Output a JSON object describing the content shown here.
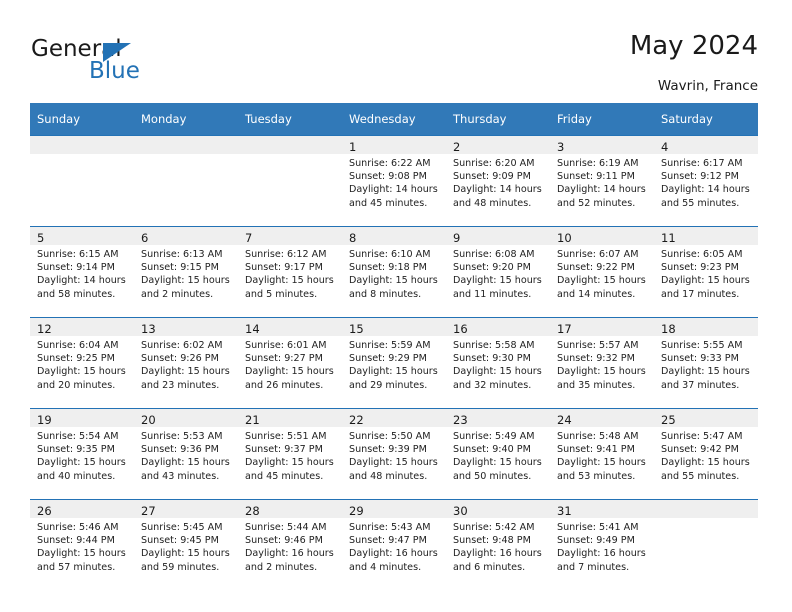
{
  "logo": {
    "word_top": "General",
    "word_bottom": "Blue",
    "triangle_icon": "blue-triangle-icon",
    "brand_color": "#2372b5"
  },
  "header": {
    "title": "May 2024",
    "subtitle": "Wavrin, France"
  },
  "theme": {
    "header_row_bg": "#3179b8",
    "header_row_text": "#ffffff",
    "row_rule": "#2372b5",
    "daynum_strip_bg": "#efefef",
    "page_bg": "#ffffff",
    "body_text": "#222222"
  },
  "calendar": {
    "weekday_headers": [
      "Sunday",
      "Monday",
      "Tuesday",
      "Wednesday",
      "Thursday",
      "Friday",
      "Saturday"
    ],
    "labels": {
      "sunrise": "Sunrise:",
      "sunset": "Sunset:",
      "daylight": "Daylight:"
    },
    "weeks": [
      [
        {
          "day": "",
          "lines": []
        },
        {
          "day": "",
          "lines": []
        },
        {
          "day": "",
          "lines": []
        },
        {
          "day": "1",
          "lines": [
            "Sunrise: 6:22 AM",
            "Sunset: 9:08 PM",
            "Daylight: 14 hours",
            "and 45 minutes."
          ]
        },
        {
          "day": "2",
          "lines": [
            "Sunrise: 6:20 AM",
            "Sunset: 9:09 PM",
            "Daylight: 14 hours",
            "and 48 minutes."
          ]
        },
        {
          "day": "3",
          "lines": [
            "Sunrise: 6:19 AM",
            "Sunset: 9:11 PM",
            "Daylight: 14 hours",
            "and 52 minutes."
          ]
        },
        {
          "day": "4",
          "lines": [
            "Sunrise: 6:17 AM",
            "Sunset: 9:12 PM",
            "Daylight: 14 hours",
            "and 55 minutes."
          ]
        }
      ],
      [
        {
          "day": "5",
          "lines": [
            "Sunrise: 6:15 AM",
            "Sunset: 9:14 PM",
            "Daylight: 14 hours",
            "and 58 minutes."
          ]
        },
        {
          "day": "6",
          "lines": [
            "Sunrise: 6:13 AM",
            "Sunset: 9:15 PM",
            "Daylight: 15 hours",
            "and 2 minutes."
          ]
        },
        {
          "day": "7",
          "lines": [
            "Sunrise: 6:12 AM",
            "Sunset: 9:17 PM",
            "Daylight: 15 hours",
            "and 5 minutes."
          ]
        },
        {
          "day": "8",
          "lines": [
            "Sunrise: 6:10 AM",
            "Sunset: 9:18 PM",
            "Daylight: 15 hours",
            "and 8 minutes."
          ]
        },
        {
          "day": "9",
          "lines": [
            "Sunrise: 6:08 AM",
            "Sunset: 9:20 PM",
            "Daylight: 15 hours",
            "and 11 minutes."
          ]
        },
        {
          "day": "10",
          "lines": [
            "Sunrise: 6:07 AM",
            "Sunset: 9:22 PM",
            "Daylight: 15 hours",
            "and 14 minutes."
          ]
        },
        {
          "day": "11",
          "lines": [
            "Sunrise: 6:05 AM",
            "Sunset: 9:23 PM",
            "Daylight: 15 hours",
            "and 17 minutes."
          ]
        }
      ],
      [
        {
          "day": "12",
          "lines": [
            "Sunrise: 6:04 AM",
            "Sunset: 9:25 PM",
            "Daylight: 15 hours",
            "and 20 minutes."
          ]
        },
        {
          "day": "13",
          "lines": [
            "Sunrise: 6:02 AM",
            "Sunset: 9:26 PM",
            "Daylight: 15 hours",
            "and 23 minutes."
          ]
        },
        {
          "day": "14",
          "lines": [
            "Sunrise: 6:01 AM",
            "Sunset: 9:27 PM",
            "Daylight: 15 hours",
            "and 26 minutes."
          ]
        },
        {
          "day": "15",
          "lines": [
            "Sunrise: 5:59 AM",
            "Sunset: 9:29 PM",
            "Daylight: 15 hours",
            "and 29 minutes."
          ]
        },
        {
          "day": "16",
          "lines": [
            "Sunrise: 5:58 AM",
            "Sunset: 9:30 PM",
            "Daylight: 15 hours",
            "and 32 minutes."
          ]
        },
        {
          "day": "17",
          "lines": [
            "Sunrise: 5:57 AM",
            "Sunset: 9:32 PM",
            "Daylight: 15 hours",
            "and 35 minutes."
          ]
        },
        {
          "day": "18",
          "lines": [
            "Sunrise: 5:55 AM",
            "Sunset: 9:33 PM",
            "Daylight: 15 hours",
            "and 37 minutes."
          ]
        }
      ],
      [
        {
          "day": "19",
          "lines": [
            "Sunrise: 5:54 AM",
            "Sunset: 9:35 PM",
            "Daylight: 15 hours",
            "and 40 minutes."
          ]
        },
        {
          "day": "20",
          "lines": [
            "Sunrise: 5:53 AM",
            "Sunset: 9:36 PM",
            "Daylight: 15 hours",
            "and 43 minutes."
          ]
        },
        {
          "day": "21",
          "lines": [
            "Sunrise: 5:51 AM",
            "Sunset: 9:37 PM",
            "Daylight: 15 hours",
            "and 45 minutes."
          ]
        },
        {
          "day": "22",
          "lines": [
            "Sunrise: 5:50 AM",
            "Sunset: 9:39 PM",
            "Daylight: 15 hours",
            "and 48 minutes."
          ]
        },
        {
          "day": "23",
          "lines": [
            "Sunrise: 5:49 AM",
            "Sunset: 9:40 PM",
            "Daylight: 15 hours",
            "and 50 minutes."
          ]
        },
        {
          "day": "24",
          "lines": [
            "Sunrise: 5:48 AM",
            "Sunset: 9:41 PM",
            "Daylight: 15 hours",
            "and 53 minutes."
          ]
        },
        {
          "day": "25",
          "lines": [
            "Sunrise: 5:47 AM",
            "Sunset: 9:42 PM",
            "Daylight: 15 hours",
            "and 55 minutes."
          ]
        }
      ],
      [
        {
          "day": "26",
          "lines": [
            "Sunrise: 5:46 AM",
            "Sunset: 9:44 PM",
            "Daylight: 15 hours",
            "and 57 minutes."
          ]
        },
        {
          "day": "27",
          "lines": [
            "Sunrise: 5:45 AM",
            "Sunset: 9:45 PM",
            "Daylight: 15 hours",
            "and 59 minutes."
          ]
        },
        {
          "day": "28",
          "lines": [
            "Sunrise: 5:44 AM",
            "Sunset: 9:46 PM",
            "Daylight: 16 hours",
            "and 2 minutes."
          ]
        },
        {
          "day": "29",
          "lines": [
            "Sunrise: 5:43 AM",
            "Sunset: 9:47 PM",
            "Daylight: 16 hours",
            "and 4 minutes."
          ]
        },
        {
          "day": "30",
          "lines": [
            "Sunrise: 5:42 AM",
            "Sunset: 9:48 PM",
            "Daylight: 16 hours",
            "and 6 minutes."
          ]
        },
        {
          "day": "31",
          "lines": [
            "Sunrise: 5:41 AM",
            "Sunset: 9:49 PM",
            "Daylight: 16 hours",
            "and 7 minutes."
          ]
        },
        {
          "day": "",
          "lines": []
        }
      ]
    ]
  }
}
